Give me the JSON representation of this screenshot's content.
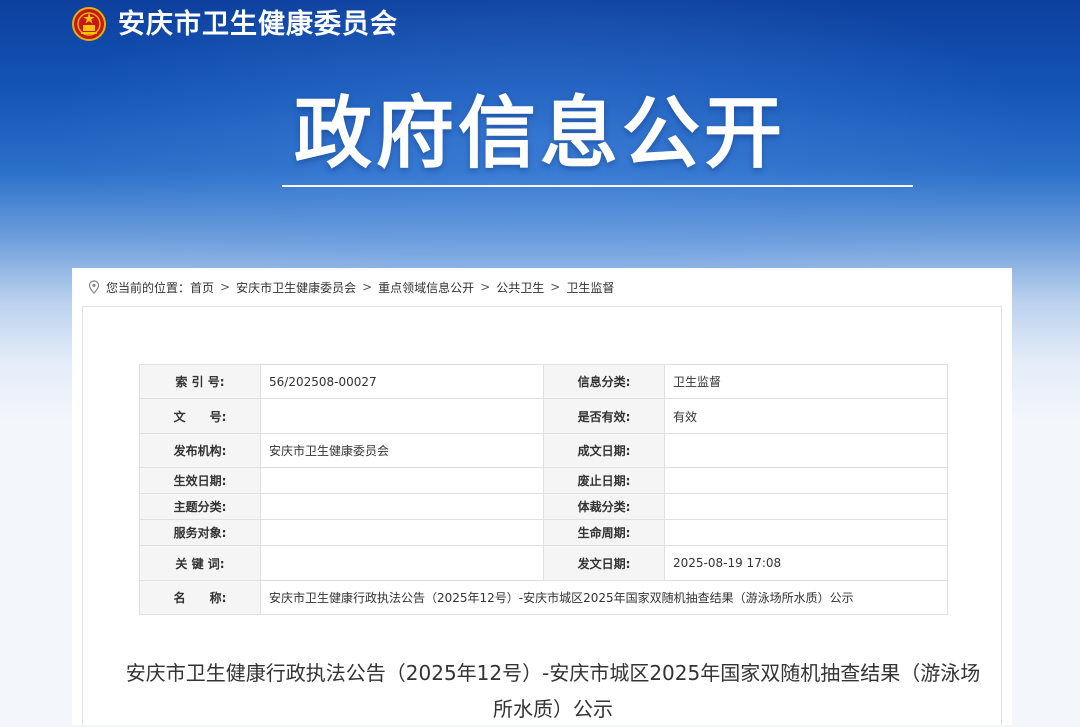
{
  "header": {
    "site_name": "安庆市卫生健康委员会",
    "hero_title": "政府信息公开",
    "emblem_icon": "national-emblem-icon",
    "colors": {
      "banner_top": "#0d3f9e",
      "banner_mid": "#2a6fc9",
      "page_bg": "#f3f6fb"
    }
  },
  "breadcrumb": {
    "prefix": "您当前的位置：",
    "items": [
      "首页",
      "安庆市卫生健康委员会",
      "重点领域信息公开",
      "公共卫生",
      "卫生监督"
    ],
    "separator": ">"
  },
  "meta": {
    "rows": [
      {
        "l1": "索 引 号:",
        "v1": "56/202508-00027",
        "l2": "信息分类:",
        "v2": "卫生监督"
      },
      {
        "l1": "文　　号:",
        "v1": "",
        "l2": "是否有效:",
        "v2": "有效"
      },
      {
        "l1": "发布机构:",
        "v1": "安庆市卫生健康委员会",
        "l2": "成文日期:",
        "v2": ""
      },
      {
        "l1": "生效日期:",
        "v1": "",
        "l2": "废止日期:",
        "v2": ""
      },
      {
        "l1": "主题分类:",
        "v1": "",
        "l2": "体裁分类:",
        "v2": ""
      },
      {
        "l1": "服务对象:",
        "v1": "",
        "l2": "生命周期:",
        "v2": ""
      },
      {
        "l1": "关 键 词:",
        "v1": "",
        "l2": "发文日期:",
        "v2": "2025-08-19 17:08"
      }
    ],
    "name_label": "名　　称:",
    "name_value": "安庆市卫生健康行政执法公告（2025年12号）-安庆市城区2025年国家双随机抽查结果（游泳场所水质）公示"
  },
  "document": {
    "title_line1": "安庆市卫生健康行政执法公告（2025年12号）-安庆市城区2025年国家双随机抽查结果（游泳场",
    "title_line2": "所水质）公示"
  }
}
